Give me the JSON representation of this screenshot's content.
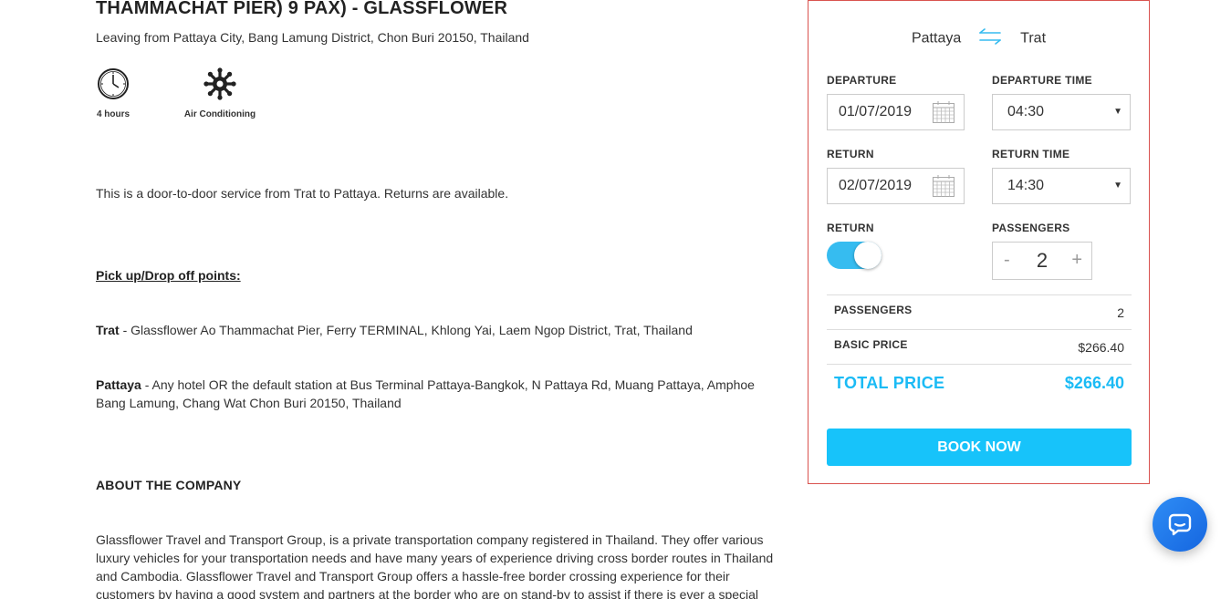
{
  "listing": {
    "title": "THAMMACHAT PIER) 9 PAX) - GLASSFLOWER",
    "subtitle": "Leaving from Pattaya City, Bang Lamung District, Chon Buri 20150, Thailand",
    "features": [
      {
        "icon": "clock-icon",
        "label": "4 hours"
      },
      {
        "icon": "snowflake-icon",
        "label": "Air Conditioning"
      }
    ],
    "intro": "This is a door-to-door service from Trat to Pattaya. Returns are available.",
    "pickup_heading": "Pick up/Drop off points:",
    "pickup_points": [
      {
        "place": "Trat",
        "text": " - Glassflower Ao Thammachat Pier, Ferry TERMINAL, Khlong Yai, Laem Ngop District, Trat, Thailand"
      },
      {
        "place": "Pattaya",
        "text": " - Any hotel OR the default station at Bus Terminal Pattaya-Bangkok, N Pattaya Rd, Muang Pattaya, Amphoe Bang Lamung, Chang Wat Chon Buri 20150, Thailand"
      }
    ],
    "about_heading": "ABOUT THE COMPANY",
    "about_text": "Glassflower Travel and Transport Group, is a private transportation company registered in Thailand. They offer various luxury vehicles for your transportation needs and have many years of experience driving cross border routes in Thailand and Cambodia. Glassflower Travel and Transport Group offers a hassle-free border crossing experience for their customers by having a good system and partners at the border who are on stand-by to assist if there is ever a special"
  },
  "booking": {
    "from": "Pattaya",
    "to": "Trat",
    "swap_icon": "swap-arrows-icon",
    "departure_label": "DEPARTURE",
    "departure_value": "01/07/2019",
    "departure_time_label": "DEPARTURE TIME",
    "departure_time_value": "04:30",
    "return_label": "RETURN",
    "return_value": "02/07/2019",
    "return_time_label": "RETURN TIME",
    "return_time_value": "14:30",
    "return_toggle_label": "RETURN",
    "return_toggle_on": true,
    "passengers_label": "PASSENGERS",
    "passengers_value": "2",
    "minus": "-",
    "plus": "+",
    "summary": {
      "passengers_label": "PASSENGERS",
      "passengers_value": "2",
      "basic_label": "BASIC PRICE",
      "basic_value": "$266.40",
      "total_label": "TOTAL PRICE",
      "total_value": "$266.40"
    },
    "book_label": "BOOK NOW",
    "accent_color": "#1bbbf5",
    "border_color": "#d9534f"
  },
  "chat": {
    "icon": "chat-bubble-icon"
  }
}
